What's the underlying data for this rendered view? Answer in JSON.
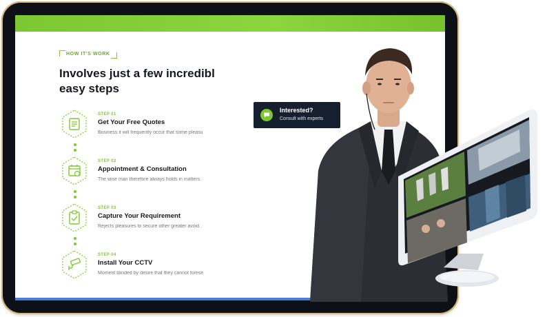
{
  "section": {
    "eyebrow": "HOW IT'S WORK",
    "heading_line1": "Involves just a few incredibl",
    "heading_line2": "easy steps"
  },
  "steps": [
    {
      "number": "STEP 01",
      "title": "Get Your Free Quotes",
      "desc": "Business it will frequently occur that some pleasu",
      "icon": "quote-document-icon"
    },
    {
      "number": "STEP 02",
      "title": "Appointment & Consultation",
      "desc": "The wise man therefore always holds in matters.",
      "icon": "calendar-icon"
    },
    {
      "number": "STEP 03",
      "title": "Capture Your Requirement",
      "desc": "Rejects pleasures to secure other greater avoid.",
      "icon": "clipboard-icon"
    },
    {
      "number": "STEP 04",
      "title": "Install Your CCTV",
      "desc": "Moment blinded by desire that they cannot forese",
      "icon": "cctv-camera-icon"
    }
  ],
  "cta": {
    "title": "Interested?",
    "subtitle": "Consult with experts",
    "icon": "chat-bubble-icon"
  },
  "colors": {
    "accent": "#7cc832",
    "dark": "#161f2e",
    "text": "#15191e",
    "muted": "#777777"
  }
}
